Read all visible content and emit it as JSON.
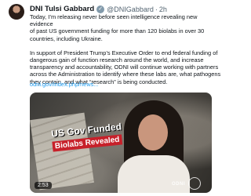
{
  "author": {
    "name": "DNI Tulsi Gabbard",
    "handle": "@DNIGabbard",
    "separator": "·",
    "time": "2h",
    "badge_icon": "government-verified-badge-icon"
  },
  "post": {
    "paragraph_1": "Today, I’m releasing never before seen intelligence revealing new evidence\nof past US government funding for more than 120 biolabs in over 30\ncountries, including Ukraine.",
    "paragraph_2": "In support of President Trump’s Executive Order to end federal funding of\ndangerous gain of function research around the world, and increase\ntransparency and accountability, ODNI will continue working with partners\nacross the Administration to identify where these labs are, what pathogens\nthey contain, and what “research” is being conducted.",
    "link_text": "odni.gov/index.php/news..."
  },
  "video": {
    "headline_line1": "US Gov Funded",
    "headline_line2": "Biolabs Revealed",
    "duration": "2:53",
    "watermark": "ODNI"
  },
  "colors": {
    "link": "#1d9bf0",
    "secondary_text": "#536471",
    "headline_banner": "#c7202a"
  }
}
